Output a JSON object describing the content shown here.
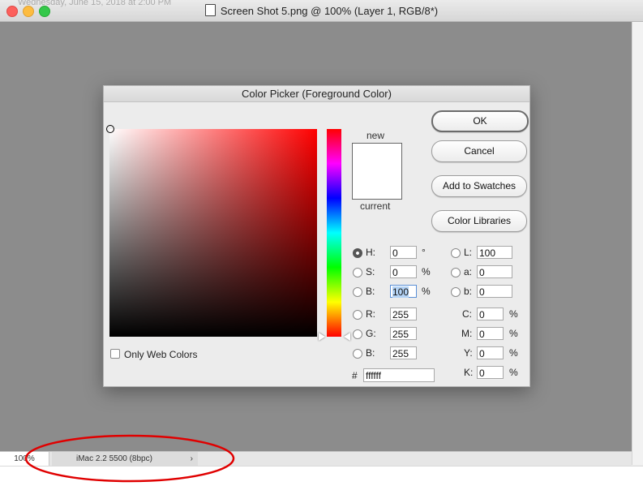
{
  "window": {
    "title": "Screen Shot 5.png @ 100% (Layer 1, RGB/8*)",
    "ghost_text": "Wednesday, June 15, 2018 at 2:00 PM"
  },
  "statusbar": {
    "zoom": "100%",
    "doc_info": "iMac 2.2 5500 (8bpc)",
    "arrow": "›"
  },
  "dialog": {
    "title": "Color Picker (Foreground Color)",
    "new_label": "new",
    "current_label": "current",
    "buttons": {
      "ok": "OK",
      "cancel": "Cancel",
      "add_to_swatches": "Add to Swatches",
      "color_libraries": "Color Libraries"
    },
    "only_web_colors": "Only Web Colors",
    "hsb": {
      "h": {
        "label": "H:",
        "value": "0",
        "unit": "°"
      },
      "s": {
        "label": "S:",
        "value": "0",
        "unit": "%"
      },
      "b": {
        "label": "B:",
        "value": "100",
        "unit": "%"
      }
    },
    "rgb": {
      "r": {
        "label": "R:",
        "value": "255"
      },
      "g": {
        "label": "G:",
        "value": "255"
      },
      "b": {
        "label": "B:",
        "value": "255"
      }
    },
    "lab": {
      "l": {
        "label": "L:",
        "value": "100"
      },
      "a": {
        "label": "a:",
        "value": "0"
      },
      "b": {
        "label": "b:",
        "value": "0"
      }
    },
    "cmyk": {
      "c": {
        "label": "C:",
        "value": "0",
        "unit": "%"
      },
      "m": {
        "label": "M:",
        "value": "0",
        "unit": "%"
      },
      "y": {
        "label": "Y:",
        "value": "0",
        "unit": "%"
      },
      "k": {
        "label": "K:",
        "value": "0",
        "unit": "%"
      }
    },
    "hex": {
      "label": "#",
      "value": "ffffff"
    },
    "colors": {
      "new_swatch": "#ffffff",
      "hue_base": "#ff0000",
      "annotation": "#e00000"
    }
  }
}
